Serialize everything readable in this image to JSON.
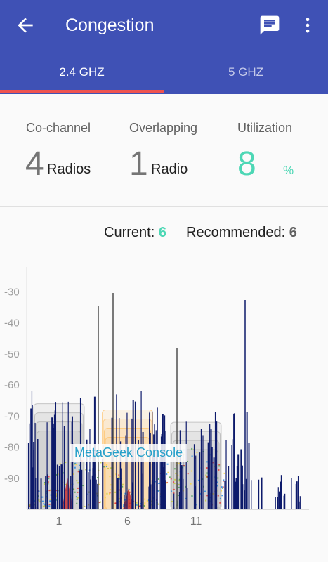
{
  "appbar": {
    "title": "Congestion",
    "back_icon": "arrow-back-icon",
    "chat_icon": "chat-icon",
    "more_icon": "more-vert-icon",
    "color": "#3f51b5"
  },
  "tabs": [
    {
      "label": "2.4 GHZ",
      "selected": true
    },
    {
      "label": "5 GHZ",
      "selected": false
    }
  ],
  "stats": {
    "cochannel": {
      "label": "Co-channel",
      "value": "4",
      "unit": "Radios"
    },
    "overlapping": {
      "label": "Overlapping",
      "value": "1",
      "unit": "Radio"
    },
    "utilization": {
      "label": "Utilization",
      "value": "8",
      "unit": "%"
    }
  },
  "channel": {
    "current_label": "Current:",
    "current_value": "6",
    "recommended_label": "Recommended:",
    "recommended_value": "6"
  },
  "watermark": "MetaGeek Console",
  "chart_data": {
    "type": "bar",
    "y_ticks": [
      "-30",
      "-40",
      "-50",
      "-60",
      "-70",
      "-80",
      "-90"
    ],
    "x_ticks": [
      "1",
      "6",
      "11"
    ],
    "ylim": [
      -100,
      -22
    ],
    "channel_boxes": [
      {
        "channel": 1,
        "top_dbm": -66
      },
      {
        "channel": 6,
        "top_dbm": -68
      },
      {
        "channel": 11,
        "top_dbm": -72
      }
    ]
  }
}
